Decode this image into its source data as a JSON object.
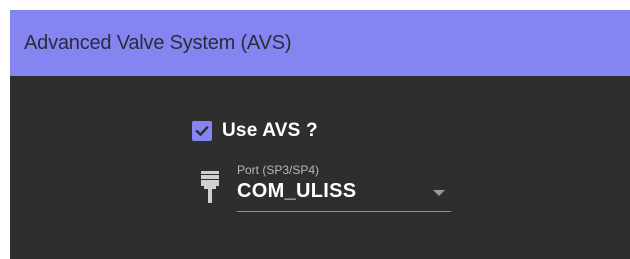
{
  "header": {
    "title": "Advanced Valve System (AVS)"
  },
  "use_avs": {
    "label": "Use AVS ?",
    "checked": true
  },
  "port_select": {
    "label": "Port (SP3/SP4)",
    "value": "COM_ULISS",
    "icon": "serial-port-icon"
  },
  "colors": {
    "accent": "#8585f2",
    "panel_background": "#2e2e2e",
    "text": "#ffffff"
  }
}
